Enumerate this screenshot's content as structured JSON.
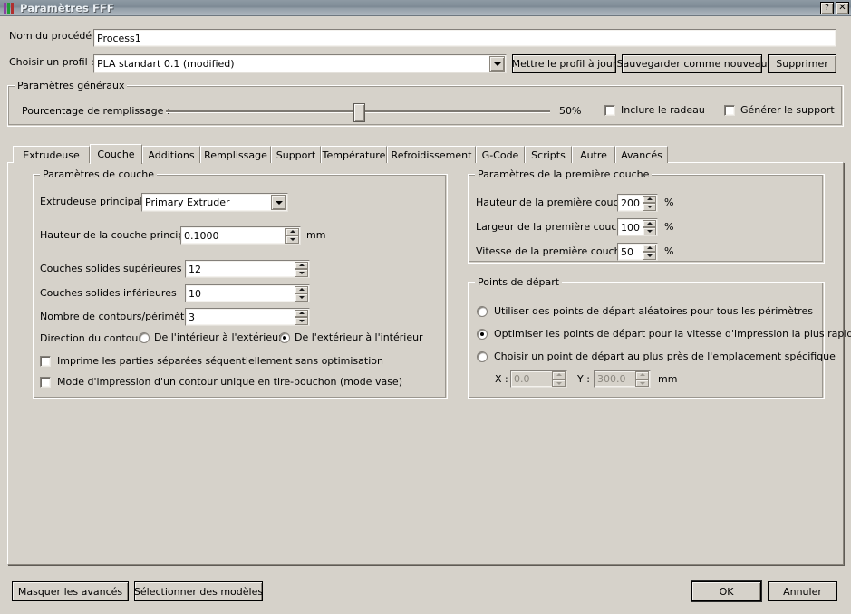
{
  "window": {
    "title": "Paramètres FFF",
    "help_button": "?",
    "close_button": "✕"
  },
  "header": {
    "process_name_label": "Nom du procédé :",
    "process_name_value": "Process1",
    "profile_label": "Choisir un profil :",
    "profile_value": "PLA standart 0.1 (modified)",
    "update_profile_button": "Mettre le profil à jour",
    "save_as_new_button": "Sauvegarder comme nouveau",
    "delete_button": "Supprimer"
  },
  "general": {
    "legend": "Paramètres généraux",
    "infill_label": "Pourcentage de remplissage :",
    "infill_value": "50%",
    "infill_percent": 50,
    "include_raft_label": "Inclure le radeau",
    "include_raft_checked": false,
    "generate_support_label": "Générer le support",
    "generate_support_checked": false
  },
  "tabs": {
    "active": "Couche",
    "items": [
      {
        "label": "Extrudeuse"
      },
      {
        "label": "Couche"
      },
      {
        "label": "Additions"
      },
      {
        "label": "Remplissage"
      },
      {
        "label": "Support"
      },
      {
        "label": "Température"
      },
      {
        "label": "Refroidissement"
      },
      {
        "label": "G-Code"
      },
      {
        "label": "Scripts"
      },
      {
        "label": "Autre"
      },
      {
        "label": "Avancés"
      }
    ]
  },
  "layer_settings": {
    "legend": "Paramètres de couche",
    "primary_extruder_label": "Extrudeuse principale",
    "primary_extruder_value": "Primary Extruder",
    "primary_layer_height_label": "Hauteur de la couche principale",
    "primary_layer_height_value": "0.1000",
    "primary_layer_height_unit": "mm",
    "top_solid_layers_label": "Couches solides supérieures",
    "top_solid_layers_value": "12",
    "bottom_solid_layers_label": "Couches solides inférieures",
    "bottom_solid_layers_value": "10",
    "perimeter_count_label": "Nombre de contours/périmètres",
    "perimeter_count_value": "3",
    "outline_direction_label": "Direction du contour :",
    "outline_inside_out_label": "De l'intérieur à l'extérieur",
    "outline_inside_out_selected": false,
    "outline_outside_in_label": "De l'extérieur à l'intérieur",
    "outline_outside_in_selected": true,
    "sequential_parts_label": "Imprime les parties séparées séquentiellement sans optimisation",
    "sequential_parts_checked": false,
    "vase_mode_label": "Mode d'impression d'un contour unique en tire-bouchon (mode vase)",
    "vase_mode_checked": false
  },
  "first_layer": {
    "legend": "Paramètres de la première couche",
    "height_label": "Hauteur de la première couche",
    "height_value": "200",
    "height_unit": "%",
    "width_label": "Largeur de la première couche",
    "width_value": "100",
    "width_unit": "%",
    "speed_label": "Vitesse de la première couche",
    "speed_value": "50",
    "speed_unit": "%"
  },
  "start_points": {
    "legend": "Points de départ",
    "random_label": "Utiliser des points de départ aléatoires pour tous les périmètres",
    "random_selected": false,
    "optimize_label": "Optimiser les points de départ pour la vitesse d'impression la plus rapide",
    "optimize_selected": true,
    "specific_label": "Choisir un point de départ au plus près de l'emplacement spécifique",
    "specific_selected": false,
    "x_label": "X :",
    "x_value": "0.0",
    "y_label": "Y :",
    "y_value": "300.0",
    "xy_unit": "mm"
  },
  "footer": {
    "hide_advanced_button": "Masquer les avancés",
    "select_models_button": "Sélectionner des modèles",
    "ok_button": "OK",
    "cancel_button": "Annuler"
  },
  "colors": {
    "window_bg": "#d6d2ca",
    "titlebar_start": "#8e9aa4",
    "titlebar_end": "#aeb7bf",
    "field_bg": "#ffffff",
    "border_dark": "#9b978f"
  }
}
